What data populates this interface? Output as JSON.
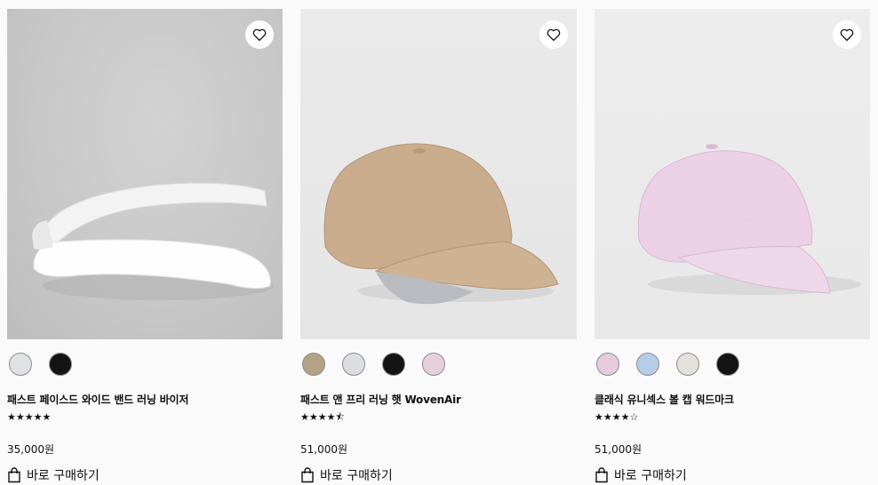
{
  "products": [
    {
      "name": "패스트 페이스드 와이드 밴드 러닝 바이저",
      "rating_stars": "★★★★★",
      "rating_value": 5.0,
      "price": "35,000원",
      "buy_label": "바로 구매하기",
      "image_icon": "white-visor-image",
      "swatch_colors": [
        "#e0e1e4",
        "#141414"
      ]
    },
    {
      "name": "패스트 앤 프리 러닝 햇 WovenAir",
      "rating_stars": "★★★★⯪",
      "rating_value": 4.5,
      "price": "51,000원",
      "buy_label": "바로 구매하기",
      "image_icon": "tan-running-cap-image",
      "swatch_colors": [
        "#b3a283",
        "#dcdde0",
        "#141414",
        "#e5d0dc"
      ]
    },
    {
      "name": "클래식 유니섹스 볼 캡 워드마크",
      "rating_stars": "★★★★☆",
      "rating_value": 4.0,
      "price": "51,000원",
      "buy_label": "바로 구매하기",
      "image_icon": "pink-ball-cap-image",
      "swatch_colors": [
        "#e3ccdb",
        "#b6cde8",
        "#e4e0dc",
        "#141414"
      ]
    }
  ]
}
